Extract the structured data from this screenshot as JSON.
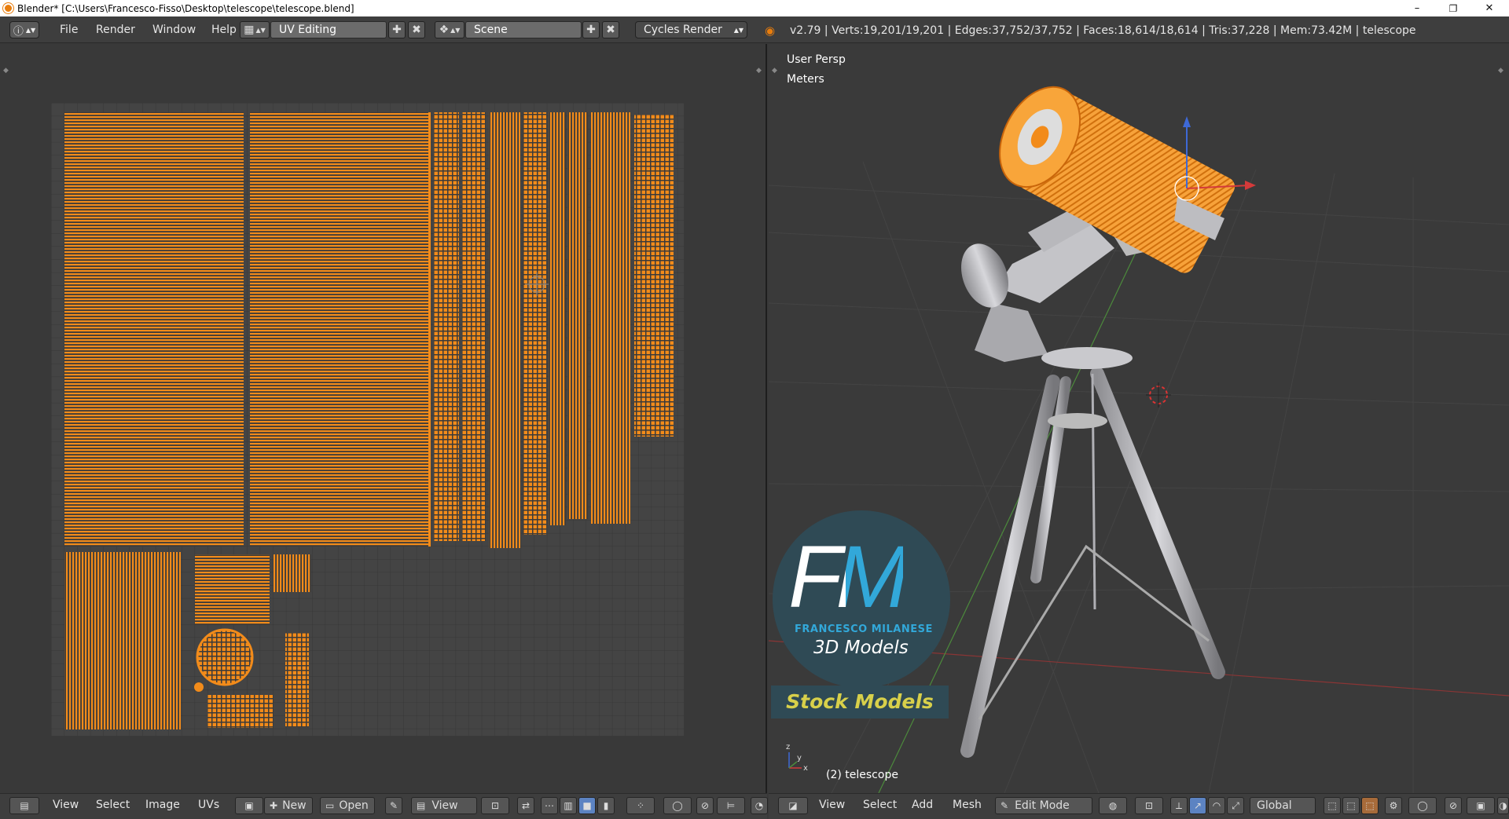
{
  "window": {
    "title": "Blender* [C:\\Users\\Francesco-Fisso\\Desktop\\telescope\\telescope.blend]",
    "minimize": "–",
    "restore": "❐",
    "close": "✕"
  },
  "info_header": {
    "menus": [
      "File",
      "Render",
      "Window",
      "Help"
    ],
    "screen_layout": "UV Editing",
    "scene": "Scene",
    "render_engine": "Cycles Render",
    "stats": "v2.79 | Verts:19,201/19,201 | Edges:37,752/37,752 | Faces:18,614/18,614 | Tris:37,228 | Mem:73.42M | telescope"
  },
  "uv_editor_footer": {
    "menus": [
      "View",
      "Select",
      "Image",
      "UVs"
    ],
    "new_label": "New",
    "open_label": "Open",
    "view_label": "View"
  },
  "viewport": {
    "view_name": "User Persp",
    "units": "Meters",
    "object_label": "(2) telescope",
    "axis_labels": {
      "z": "z",
      "y": "y",
      "x": "x"
    }
  },
  "viewport_footer": {
    "menus": [
      "View",
      "Select",
      "Add",
      "Mesh"
    ],
    "mode": "Edit Mode",
    "orientation": "Global"
  },
  "watermark": {
    "letters": "FM",
    "name": "FRANCESCO MILANESE",
    "tagline": "3D Models",
    "banner": "Stock Models"
  },
  "colors": {
    "uv_orange": "#f28b1a",
    "background": "#393939",
    "header": "#3e3e3e",
    "watermark_cyan": "#32a8d9",
    "banner_yellow": "#d8d04a"
  }
}
